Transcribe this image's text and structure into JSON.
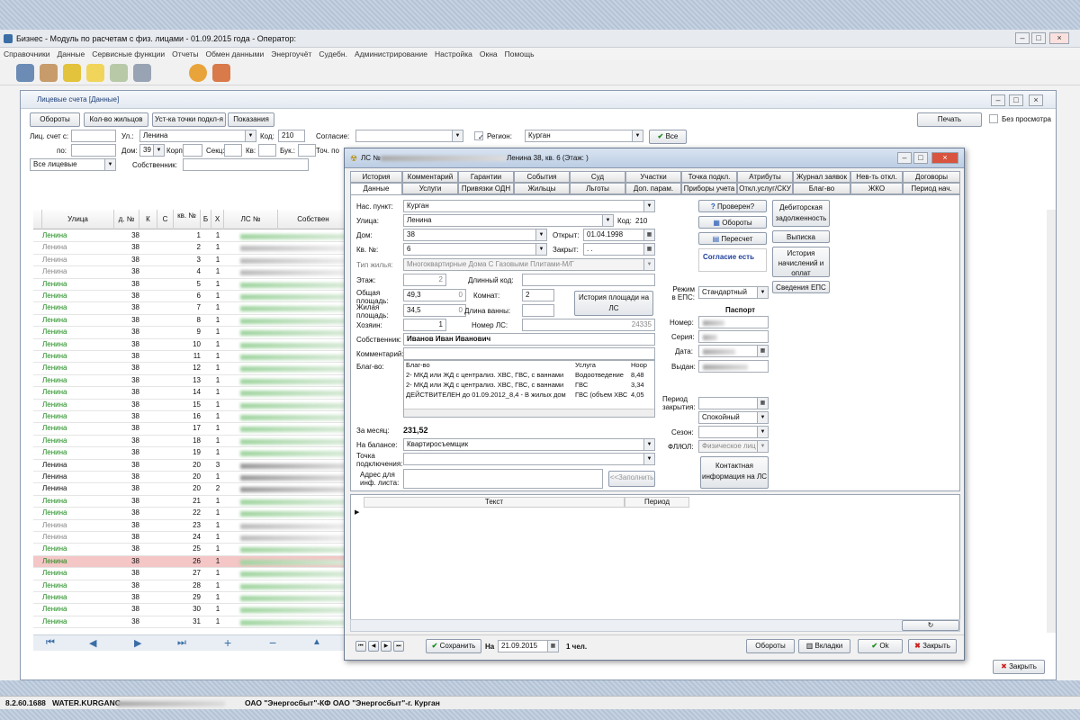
{
  "window": {
    "title": "Бизнес - Модуль по расчетам с физ. лицами - 01.09.2015 года - Оператор:"
  },
  "menu": [
    "Справочники",
    "Данные",
    "Сервисные функции",
    "Отчеты",
    "Обмен данными",
    "Энергоучёт",
    "Судебн.",
    "Администрирование",
    "Настройка",
    "Окна",
    "Помощь"
  ],
  "mdi": {
    "title": "Лицевые счета [Данные]",
    "toolbar": [
      "Обороты",
      "Кол-во жильцов",
      "Уст-ка точки подкл-я",
      "Показания"
    ],
    "print": "Печать",
    "no_preview": "Без просмотра",
    "filter": {
      "ls_from": "Лиц. счет с:",
      "to": "по:",
      "street": "Ул.:",
      "street_val": "Ленина",
      "kod": "Код:",
      "kod_val": "210",
      "dom": "Дом:",
      "dom_val": "39",
      "korp": "Корп",
      "sekc": "Секц:",
      "kv": "Кв:",
      "buk": "Бук.:",
      "all": "Все лицевые",
      "owner": "Собственник:",
      "consent": "Согласие:",
      "region_lbl": "Регион:",
      "region_val": "Курган",
      "tochpo": "Точ. по",
      "all_btn": "Все"
    },
    "grid": {
      "cols": [
        "Улица",
        "д. №",
        "К",
        "С",
        "кв. №",
        "Б",
        "Х",
        "ЛС №",
        "Собствен"
      ],
      "rows": [
        {
          "s": "Ленина",
          "d": "38",
          "k": "",
          "c": "",
          "kv": "1",
          "b": "",
          "x": "1",
          "t": "g"
        },
        {
          "s": "Ленина",
          "d": "38",
          "k": "",
          "c": "",
          "kv": "2",
          "b": "",
          "x": "1",
          "t": "gr"
        },
        {
          "s": "Ленина",
          "d": "38",
          "k": "",
          "c": "",
          "kv": "3",
          "b": "",
          "x": "1",
          "t": "gr"
        },
        {
          "s": "Ленина",
          "d": "38",
          "k": "",
          "c": "",
          "kv": "4",
          "b": "",
          "x": "1",
          "t": "gr"
        },
        {
          "s": "Ленина",
          "d": "38",
          "k": "",
          "c": "",
          "kv": "5",
          "b": "",
          "x": "1",
          "t": "g"
        },
        {
          "s": "Ленина",
          "d": "38",
          "k": "",
          "c": "",
          "kv": "6",
          "b": "",
          "x": "1",
          "t": "g"
        },
        {
          "s": "Ленина",
          "d": "38",
          "k": "",
          "c": "",
          "kv": "7",
          "b": "",
          "x": "1",
          "t": "g"
        },
        {
          "s": "Ленина",
          "d": "38",
          "k": "",
          "c": "",
          "kv": "8",
          "b": "",
          "x": "1",
          "t": "g"
        },
        {
          "s": "Ленина",
          "d": "38",
          "k": "",
          "c": "",
          "kv": "9",
          "b": "",
          "x": "1",
          "t": "g"
        },
        {
          "s": "Ленина",
          "d": "38",
          "k": "",
          "c": "",
          "kv": "10",
          "b": "",
          "x": "1",
          "t": "g"
        },
        {
          "s": "Ленина",
          "d": "38",
          "k": "",
          "c": "",
          "kv": "11",
          "b": "",
          "x": "1",
          "t": "g"
        },
        {
          "s": "Ленина",
          "d": "38",
          "k": "",
          "c": "",
          "kv": "12",
          "b": "",
          "x": "1",
          "t": "g"
        },
        {
          "s": "Ленина",
          "d": "38",
          "k": "",
          "c": "",
          "kv": "13",
          "b": "",
          "x": "1",
          "t": "g"
        },
        {
          "s": "Ленина",
          "d": "38",
          "k": "",
          "c": "",
          "kv": "14",
          "b": "",
          "x": "1",
          "t": "g"
        },
        {
          "s": "Ленина",
          "d": "38",
          "k": "",
          "c": "",
          "kv": "15",
          "b": "",
          "x": "1",
          "t": "g"
        },
        {
          "s": "Ленина",
          "d": "38",
          "k": "",
          "c": "",
          "kv": "16",
          "b": "",
          "x": "1",
          "t": "g"
        },
        {
          "s": "Ленина",
          "d": "38",
          "k": "",
          "c": "",
          "kv": "17",
          "b": "",
          "x": "1",
          "t": "g"
        },
        {
          "s": "Ленина",
          "d": "38",
          "k": "",
          "c": "",
          "kv": "18",
          "b": "",
          "x": "1",
          "t": "g"
        },
        {
          "s": "Ленина",
          "d": "38",
          "k": "",
          "c": "",
          "kv": "19",
          "b": "",
          "x": "1",
          "t": "g"
        },
        {
          "s": "Ленина",
          "d": "38",
          "k": "",
          "c": "",
          "kv": "20",
          "b": "",
          "x": "3",
          "t": "b"
        },
        {
          "s": "Ленина",
          "d": "38",
          "k": "",
          "c": "",
          "kv": "20",
          "b": "",
          "x": "1",
          "t": "b"
        },
        {
          "s": "Ленина",
          "d": "38",
          "k": "",
          "c": "",
          "kv": "20",
          "b": "",
          "x": "2",
          "t": "b"
        },
        {
          "s": "Ленина",
          "d": "38",
          "k": "",
          "c": "",
          "kv": "21",
          "b": "",
          "x": "1",
          "t": "g"
        },
        {
          "s": "Ленина",
          "d": "38",
          "k": "",
          "c": "",
          "kv": "22",
          "b": "",
          "x": "1",
          "t": "g"
        },
        {
          "s": "Ленина",
          "d": "38",
          "k": "",
          "c": "",
          "kv": "23",
          "b": "",
          "x": "1",
          "t": "gr"
        },
        {
          "s": "Ленина",
          "d": "38",
          "k": "",
          "c": "",
          "kv": "24",
          "b": "",
          "x": "1",
          "t": "gr"
        },
        {
          "s": "Ленина",
          "d": "38",
          "k": "",
          "c": "",
          "kv": "25",
          "b": "",
          "x": "1",
          "t": "g"
        },
        {
          "s": "Ленина",
          "d": "38",
          "k": "",
          "c": "",
          "kv": "26",
          "b": "",
          "x": "1",
          "t": "sel"
        },
        {
          "s": "Ленина",
          "d": "38",
          "k": "",
          "c": "",
          "kv": "27",
          "b": "",
          "x": "1",
          "t": "g"
        },
        {
          "s": "Ленина",
          "d": "38",
          "k": "",
          "c": "",
          "kv": "28",
          "b": "",
          "x": "1",
          "t": "g"
        },
        {
          "s": "Ленина",
          "d": "38",
          "k": "",
          "c": "",
          "kv": "29",
          "b": "",
          "x": "1",
          "t": "g"
        },
        {
          "s": "Ленина",
          "d": "38",
          "k": "",
          "c": "",
          "kv": "30",
          "b": "",
          "x": "1",
          "t": "g"
        },
        {
          "s": "Ленина",
          "d": "38",
          "k": "",
          "c": "",
          "kv": "31",
          "b": "",
          "x": "1",
          "t": "g"
        }
      ]
    },
    "close": "Закрыть"
  },
  "dialog": {
    "title_pre": "ЛС №",
    "title_post": "Ленина 38, кв. 6 (Этаж: )",
    "tabs_row1": [
      "История",
      "Комментарий",
      "Гарантии",
      "События",
      "Суд",
      "Участки",
      "Точка подкл.",
      "Атрибуты",
      "Журнал заявок",
      "Нев-ть откл.",
      "Договоры"
    ],
    "tabs_row2": [
      "Данные",
      "Услуги",
      "Привязки ОДН",
      "Жильцы",
      "Льготы",
      "Доп. парам.",
      "Приборы учета",
      "Откл.услуг/СКУ",
      "Благ-во",
      "ЖКО",
      "Период нач."
    ],
    "f": {
      "nas_l": "Нас. пункт:",
      "nas": "Курган",
      "ul_l": "Улица:",
      "ul": "Ленина",
      "kod_l": "Код:",
      "kod": "210",
      "dom_l": "Дом:",
      "dom": "38",
      "otkr_l": "Открыт:",
      "otkr": "01.04.1998",
      "kv_l": "Кв. №:",
      "kv": "6",
      "zakr_l": "Закрыт:",
      "zakr": ". .",
      "tip_l": "Тип жилья:",
      "tip": "Многоквартирные Дома С Газовыми Плитами-М/Г",
      "etazh_l": "Этаж:",
      "etazh": "2",
      "dkod_l": "Длинный код:",
      "obsh_l": "Общая площадь:",
      "obsh": "49,3",
      "obsh2": "0",
      "komn_l": "Комнат:",
      "komn": "2",
      "zhil_l": "Жилая площадь:",
      "zhil": "34,5",
      "zhil2": "0",
      "dlina_l": "Длина ванны:",
      "hoz_l": "Хозяин:",
      "hoz": "1",
      "nomer_l": "Номер ЛС:",
      "nomer": "24335",
      "hist_btn": "История площади на ЛС",
      "sobst_l": "Собственник:",
      "sobst": "Иванов Иван Иванович",
      "komm_l": "Комментарий:",
      "blag_l": "Благ-во:",
      "blag_head": [
        "Благ-во",
        "Услуга",
        "Ноор"
      ],
      "blag_rows": [
        [
          "2- МКД или ЖД с централиз. ХВС, ГВС, с ваннами",
          "Водоотведение",
          "8,48"
        ],
        [
          "2- МКД или ЖД с централиз. ХВС, ГВС, с ваннами",
          "ГВС",
          "3,34"
        ],
        [
          "ДЕЙСТВИТЕЛЕН до 01.09.2012_8,4 - В жилых дом",
          "ГВС (объем ХВС",
          "4,05"
        ]
      ],
      "zames_l": "За месяц:",
      "zames": "231,52",
      "bal_l": "На балансе:",
      "bal": "Квартиросъемщик",
      "tp_l": "Точка подключения:",
      "adr_l": "Адрес для инф. листа:",
      "fill_btn": "<<Заполнить",
      "checked": "Проверен?",
      "oboroty": "Обороты",
      "pereschet": "Пересчет",
      "soglasie": "Согласие есть",
      "deb": "Дебиторская задолженность",
      "vypiska": "Выписка",
      "ist_nach": "История начислений и оплат",
      "sved": "Сведения ЕПС",
      "rezhim_l": "Режим в ЕПС:",
      "rezhim": "Стандартный",
      "pasp": "Паспорт",
      "nomer2_l": "Номер:",
      "seria_l": "Серия:",
      "data_l": "Дата:",
      "vydan_l": "Выдан:",
      "per_l": "Период закрытия:",
      "spok": "Спокойный",
      "sezon_l": "Сезон:",
      "flul_l": "ФЛ/ЮЛ:",
      "flul": "Физическое лиц",
      "kontakt": "Контактная информация на ЛС"
    },
    "notes_head": [
      "Текст",
      "Период"
    ],
    "bottom": {
      "save": "Сохранить",
      "na": "На",
      "date": "21.09.2015",
      "users": "1 чел.",
      "oboroty": "Обороты",
      "vkladki": "Вкладки",
      "ok": "Ok",
      "close": "Закрыть"
    }
  },
  "status": {
    "ver": "8.2.60.1688",
    "db": "WATER.KURGANC",
    "org": "ОАО \"Энергосбыт\"-КФ ОАО \"Энергосбыт\"-г. Курган"
  }
}
